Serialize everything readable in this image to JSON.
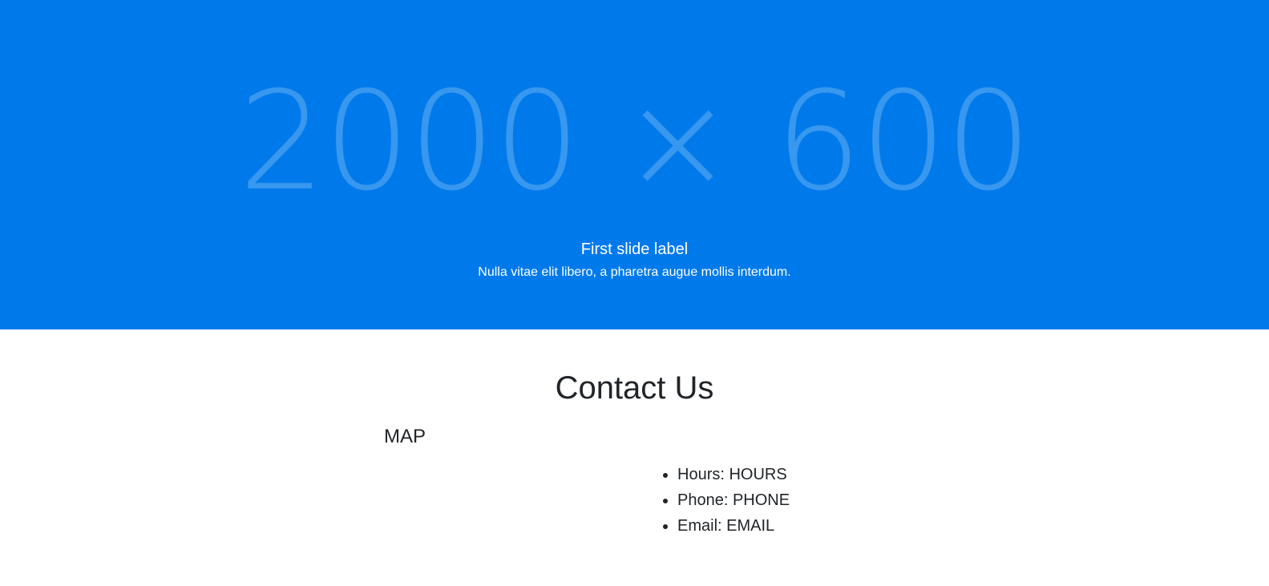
{
  "hero": {
    "placeholder": "2000 × 600",
    "caption_title": "First slide label",
    "caption_text": "Nulla vitae elit libero, a pharetra augue mollis interdum.",
    "background_color": "#007aeb"
  },
  "contact": {
    "title": "Contact Us",
    "map_label": "MAP",
    "info": [
      "Hours: HOURS",
      "Phone: PHONE",
      "Email: EMAIL"
    ]
  }
}
